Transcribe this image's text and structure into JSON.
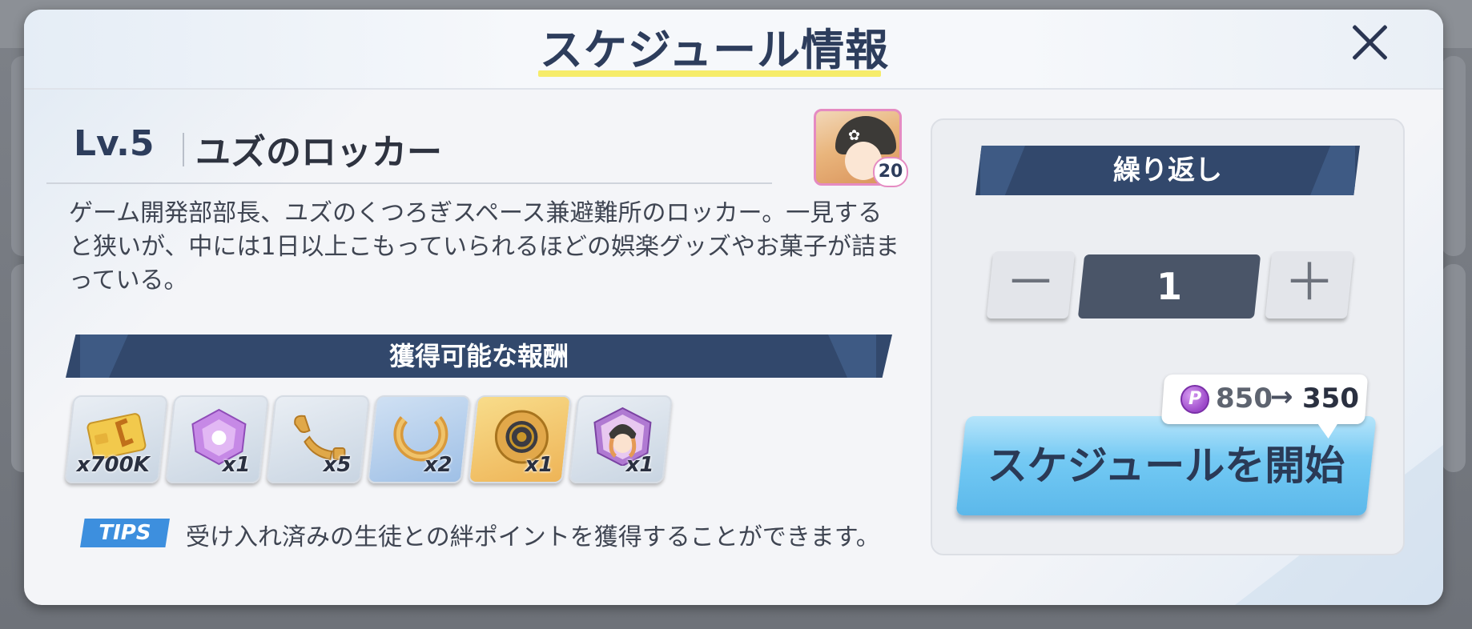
{
  "dialog": {
    "title": "スケジュール情報"
  },
  "location": {
    "level": "Lv.5",
    "name": "ユズのロッカー",
    "description": "ゲーム開発部部長、ユズのくつろぎスペース兼避難所のロッカー。一見すると狭いが、中には1日以上こもっていられるほどの娯楽グッズやお菓子が詰まっている。",
    "portrait_badge": "20"
  },
  "rewards": {
    "title": "獲得可能な報酬",
    "items": [
      {
        "icon": "credit-card-icon",
        "qty": "x700K"
      },
      {
        "icon": "purple-gem-icon",
        "qty": "x1"
      },
      {
        "icon": "gold-fragment-icon",
        "qty": "x5"
      },
      {
        "icon": "gold-ring-icon",
        "qty": "x2"
      },
      {
        "icon": "gold-disc-icon",
        "qty": "x1"
      },
      {
        "icon": "student-gift-icon",
        "qty": "x1"
      }
    ]
  },
  "tips": {
    "badge": "TIPS",
    "text": "受け入れ済みの生徒との絆ポイントを獲得することができます。"
  },
  "repeat": {
    "title": "繰り返し",
    "value": "1",
    "minus_glyph": "－",
    "plus_glyph": "＋"
  },
  "cost": {
    "icon_letter": "P",
    "from": "850",
    "arrow": "→",
    "to": "350"
  },
  "start_button": {
    "label": "スケジュールを開始"
  },
  "colors": {
    "navy": "#32486c",
    "title_underline": "#f6ec6a",
    "start_button": "#6ec6f2",
    "tips_badge": "#3d8fde",
    "portrait_border": "#e58bc2"
  }
}
